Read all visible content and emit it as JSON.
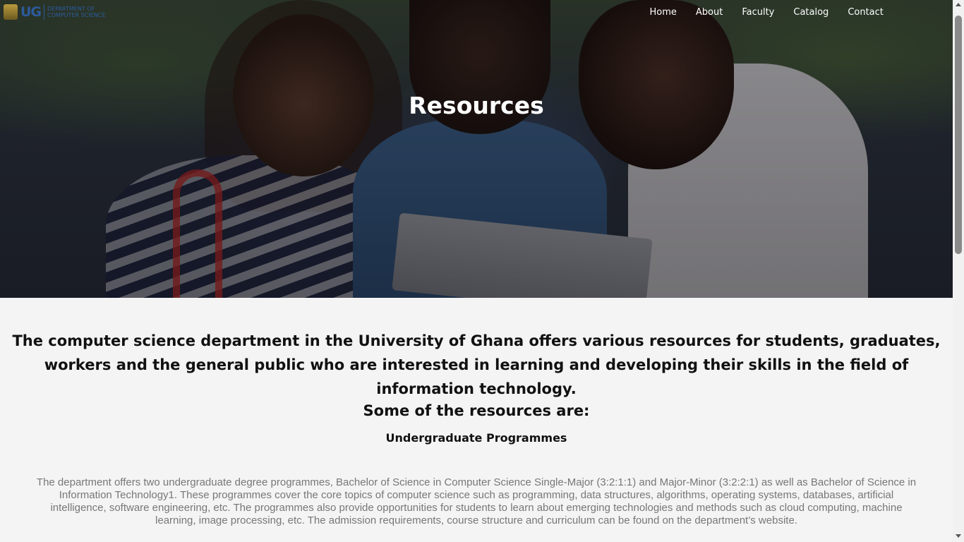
{
  "brand": {
    "logo_mark": "UG",
    "logo_text_line1": "DEPARTMENT OF",
    "logo_text_line2": "COMPUTER SCIENCE"
  },
  "nav": {
    "items": [
      {
        "label": "Home"
      },
      {
        "label": "About"
      },
      {
        "label": "Faculty"
      },
      {
        "label": "Catalog"
      },
      {
        "label": "Contact"
      }
    ]
  },
  "hero": {
    "title": "Resources"
  },
  "main": {
    "lead": "The computer science department in the University of Ghana offers various resources for students, graduates, workers and the general public who are interested in learning and developing their skills in the field of information technology.",
    "resources_heading": "Some of the resources are:",
    "section_title": "Undergraduate Programmes",
    "section_body": "The department offers two undergraduate degree programmes, Bachelor of Science in Computer Science Single-Major (3:2:1:1) and Major-Minor (3:2:2:1) as well as Bachelor of Science in Information Technology1. These programmes cover the core topics of computer science such as programming, data structures, algorithms, operating systems, databases, artificial intelligence, software engineering, etc. The programmes also provide opportunities for students to learn about emerging technologies and methods such as cloud computing, machine learning, image processing, etc. The admission requirements, course structure and curriculum can be found on the department’s website."
  },
  "colors": {
    "brand_blue": "#2c5a9c",
    "page_bg": "#f4f4f4",
    "body_text_gray": "#777777"
  }
}
